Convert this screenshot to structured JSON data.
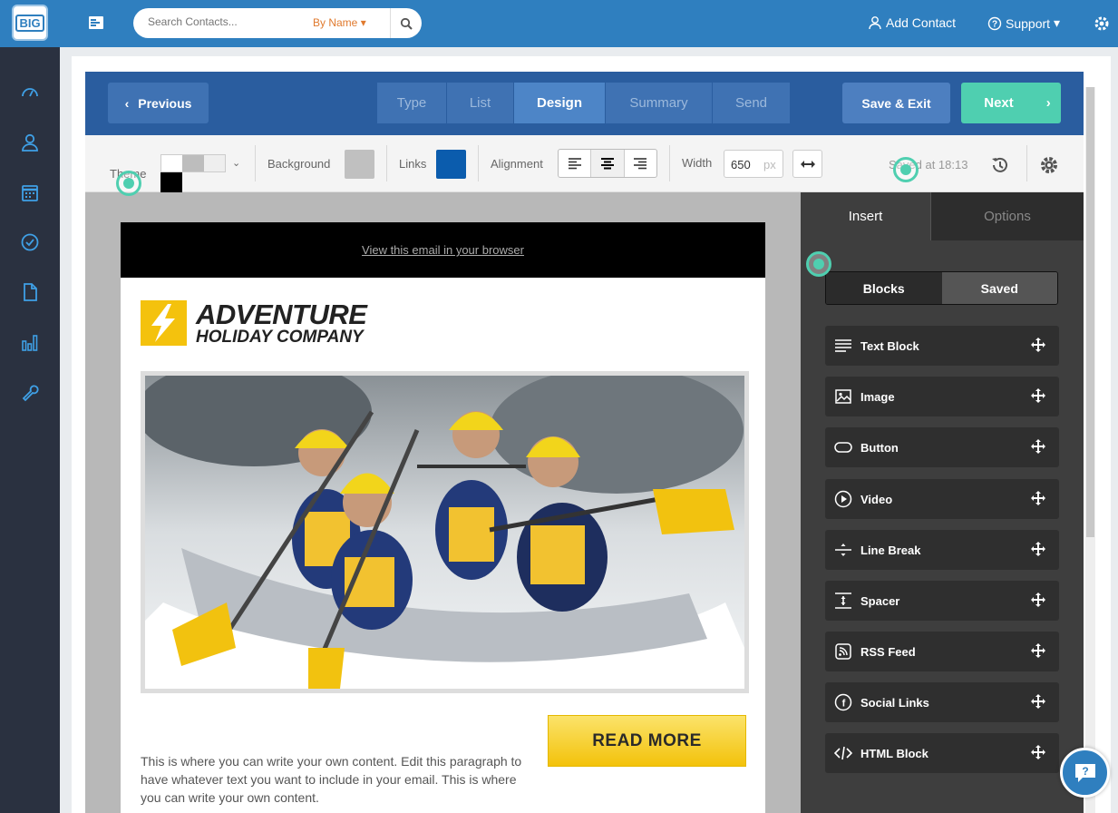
{
  "app": {
    "logo_text": "BIG"
  },
  "header": {
    "search_placeholder": "Search Contacts...",
    "search_mode": "By Name",
    "add_contact": "Add Contact",
    "support": "Support"
  },
  "sidebar": {
    "items": [
      "dashboard-icon",
      "contacts-icon",
      "calendar-icon",
      "tasks-icon",
      "documents-icon",
      "reports-icon",
      "tools-icon"
    ]
  },
  "wizard": {
    "previous": "Previous",
    "steps": [
      {
        "label": "Type",
        "active": false
      },
      {
        "label": "List",
        "active": false
      },
      {
        "label": "Design",
        "active": true
      },
      {
        "label": "Summary",
        "active": false
      },
      {
        "label": "Send",
        "active": false
      }
    ],
    "save_exit": "Save & Exit",
    "next": "Next"
  },
  "toolbar": {
    "theme_label": "Theme",
    "background_label": "Background",
    "background_color": "#c0c0c0",
    "links_label": "Links",
    "links_color": "#0b5cad",
    "alignment_label": "Alignment",
    "alignment_selected": "center",
    "width_label": "Width",
    "width_value": "650",
    "width_unit": "px",
    "saved_text": "Saved at 18:13"
  },
  "email": {
    "view_in_browser": "View this email in your browser",
    "brand_line1": "ADVENTURE",
    "brand_line2": "HOLIDAY COMPANY",
    "read_more": "READ MORE",
    "body_text": "This is where you can write your own content. Edit this paragraph to have whatever text you want to include in your email. This is where you can write your own content."
  },
  "panel": {
    "tabs": [
      {
        "label": "Insert",
        "active": true
      },
      {
        "label": "Options",
        "active": false
      }
    ],
    "segments": [
      "Blocks",
      "Saved"
    ],
    "blocks": [
      {
        "label": "Text Block",
        "icon": "text-block-icon"
      },
      {
        "label": "Image",
        "icon": "image-icon"
      },
      {
        "label": "Button",
        "icon": "button-icon"
      },
      {
        "label": "Video",
        "icon": "video-icon"
      },
      {
        "label": "Line Break",
        "icon": "line-break-icon"
      },
      {
        "label": "Spacer",
        "icon": "spacer-icon"
      },
      {
        "label": "RSS Feed",
        "icon": "rss-icon"
      },
      {
        "label": "Social Links",
        "icon": "social-icon"
      },
      {
        "label": "HTML Block",
        "icon": "html-icon"
      }
    ]
  },
  "colors": {
    "topbar": "#2f7fbf",
    "sidebar": "#2a3140",
    "wizard": "#2a5d9f",
    "accent": "#4fcfb0"
  }
}
